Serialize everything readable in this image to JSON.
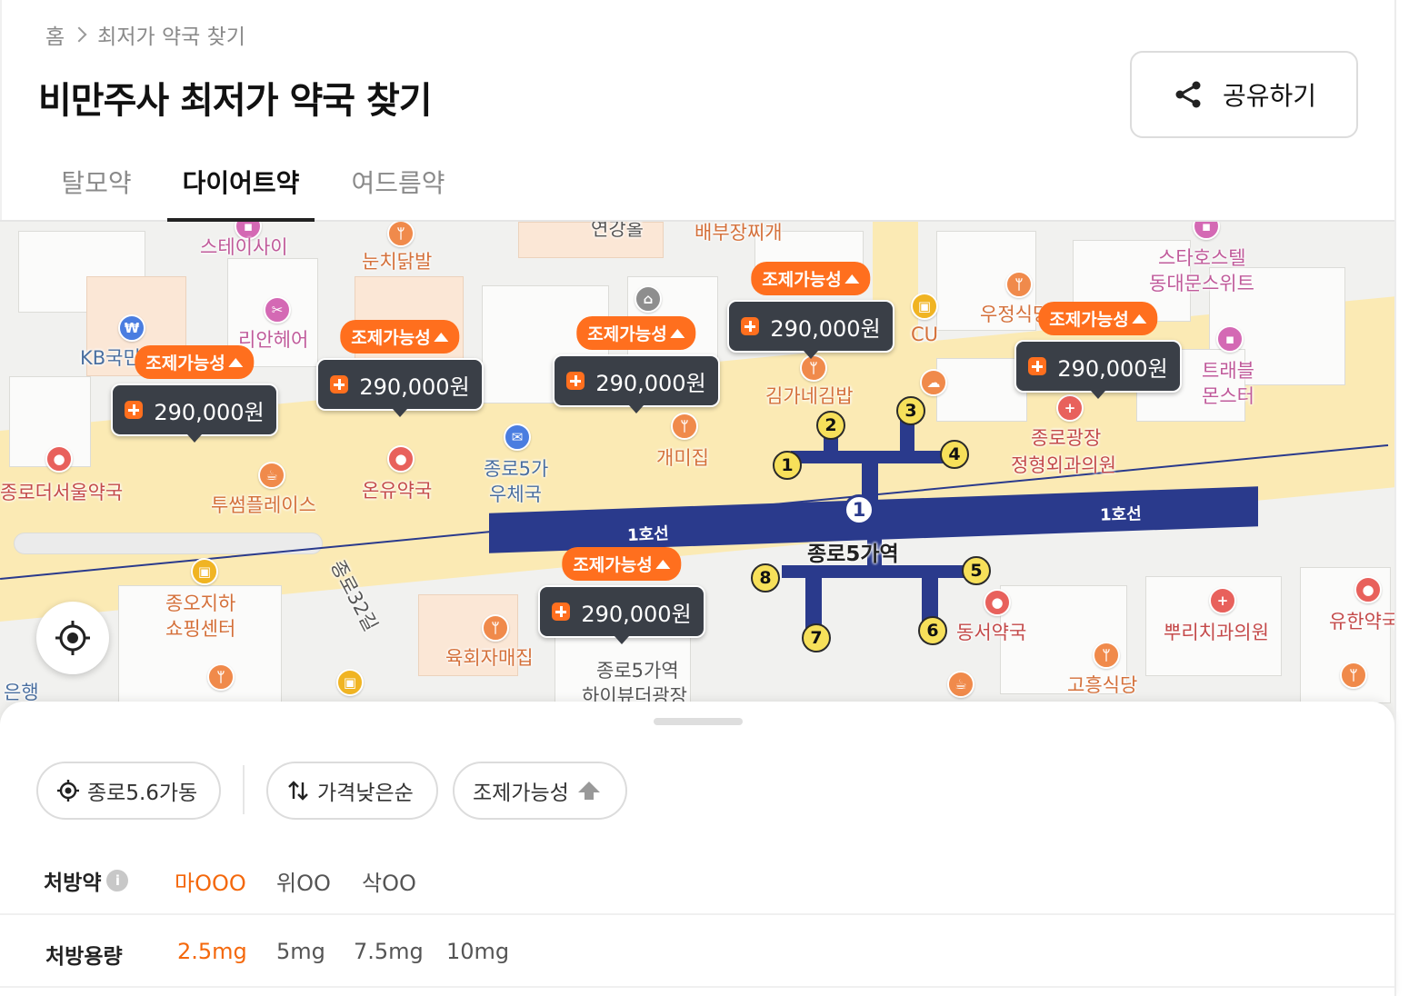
{
  "breadcrumb": {
    "home": "홈",
    "current": "최저가 약국 찾기"
  },
  "page_title": "비만주사 최저가 약국 찾기",
  "share_label": "공유하기",
  "tabs": [
    {
      "label": "탈모약",
      "active": false
    },
    {
      "label": "다이어트약",
      "active": true
    },
    {
      "label": "여드름약",
      "active": false
    }
  ],
  "map": {
    "labels": {
      "staisai": "스테이사이",
      "nunchi": "눈치닭발",
      "yeongang": "연강홀",
      "baebu": "배부장찌개",
      "stazhostel1": "스타호스텔",
      "stazhostel2": "동대문스위트",
      "ujeong": "우정식당",
      "cu": "CU",
      "travel1": "트래블",
      "travel2": "몬스터",
      "kb": "KB국민은행",
      "rian": "리안헤어",
      "kimga": "김가네김밥",
      "jongro_clinic1": "종로광장",
      "jongro_clinic2": "정형외과의원",
      "gaemi": "개미집",
      "post1": "종로5가",
      "post2": "우체국",
      "onyu": "온유약국",
      "jongro_seoul": "종로더서울약국",
      "tusome": "투썸플레이스",
      "jongo1": "종오지하",
      "jongo2": "쇼핑센터",
      "road32": "종로32길",
      "yukhoe": "육회자매집",
      "hibeauty1": "종로5가역",
      "hibeauty2": "하이뷰더광장",
      "dongseo": "동서약국",
      "ppuri": "뿌리치과의원",
      "yuhan": "유한약국",
      "goheung": "고흥식당",
      "bank": "은행",
      "station_name": "종로5가역",
      "line_left": "1호선",
      "line_right": "1호선",
      "line_num": "1"
    },
    "exits": [
      "1",
      "2",
      "3",
      "4",
      "5",
      "6",
      "7",
      "8"
    ],
    "markers": [
      {
        "tag": "조제가능성",
        "price": "290,000원"
      },
      {
        "tag": "조제가능성",
        "price": "290,000원"
      },
      {
        "tag": "조제가능성",
        "price": "290,000원"
      },
      {
        "tag": "조제가능성",
        "price": "290,000원"
      },
      {
        "tag": "조제가능성",
        "price": "290,000원"
      },
      {
        "tag": "조제가능성",
        "price": "290,000원"
      }
    ]
  },
  "filters": {
    "location": "종로5.6가동",
    "sort": "가격낮은순",
    "availability": "조제가능성"
  },
  "prescription": {
    "label": "처방약",
    "options": [
      "마OOO",
      "위OO",
      "삭OO"
    ],
    "selected": 0
  },
  "dosage": {
    "label": "처방용량",
    "options": [
      "2.5mg",
      "5mg",
      "7.5mg",
      "10mg"
    ],
    "selected": 0
  },
  "colors": {
    "accent": "#f4680c",
    "tag": "#ff6f1e",
    "marker": "#3a3f47",
    "subway": "#2a3a8c"
  }
}
